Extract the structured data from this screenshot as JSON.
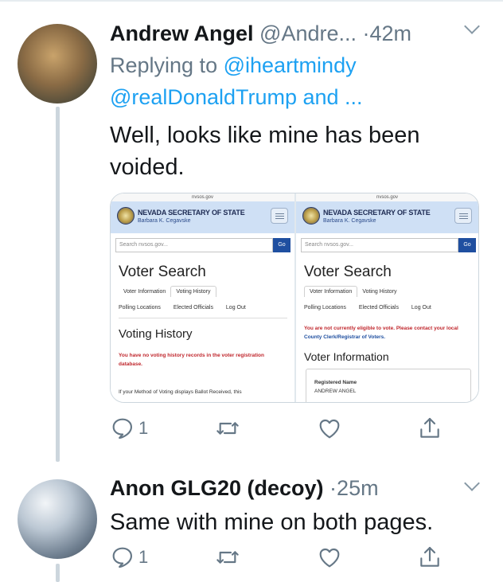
{
  "tweets": [
    {
      "display_name": "Andrew Angel",
      "handle": "@Andre...",
      "separator": "·",
      "time": "42m",
      "replying_prefix": "Replying to",
      "replying_mentions": "@iheartmindy @realDonaldTrump and ...",
      "text": "Well, looks like mine has been voided.",
      "reply_count": "1",
      "media": {
        "url_label": "nvsos.gov",
        "site_title": "NEVADA SECRETARY OF STATE",
        "site_subtitle": "Barbara K. Cegavske",
        "search_placeholder": "Search nvsos.gov...",
        "go_label": "Go",
        "heading": "Voter Search",
        "tab_voter_information": "Voter Information",
        "tab_voting_history": "Voting History",
        "link_polling_locations": "Polling Locations",
        "link_elected_officials": "Elected Officials",
        "link_log_out": "Log Out",
        "left": {
          "section_title": "Voting History",
          "warning": "You have no voting history records in the voter registration database.",
          "fine_print": "If your Method of Voting displays Ballot Received, this"
        },
        "right": {
          "warning_part1": "You are not currently eligible to vote. Please contact your local",
          "warning_part2": "County Clerk/Registrar of Voters.",
          "section_title": "Voter Information",
          "registered_label": "Registered Name",
          "registered_name": "ANDREW ANGEL"
        }
      }
    },
    {
      "display_name": "Anon GLG20 (decoy)",
      "separator": "·",
      "time": "25m",
      "text": "Same with mine on both pages.",
      "reply_count": "1"
    }
  ],
  "colors": {
    "link": "#1da1f2",
    "secondary_text": "#657786",
    "thread_line": "#ccd6dd",
    "warning_red": "#c0272d"
  },
  "icons": [
    "reply-icon",
    "retweet-icon",
    "like-icon",
    "share-icon",
    "chevron-down-icon",
    "state-seal-icon",
    "hamburger-menu-icon"
  ]
}
